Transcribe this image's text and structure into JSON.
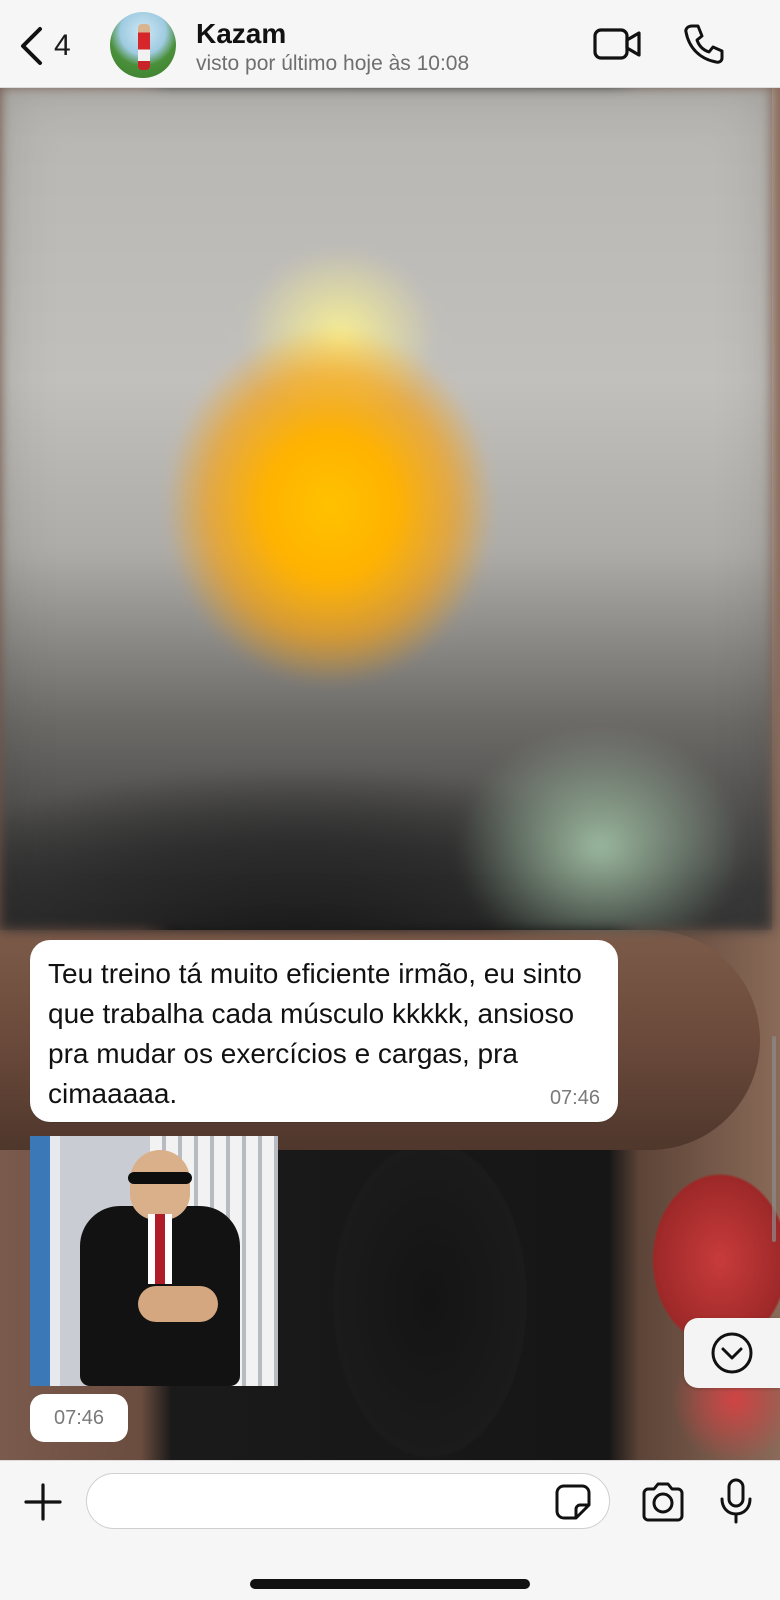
{
  "header": {
    "back_count": "4",
    "contact_name": "Kazam",
    "last_seen": "visto por último hoje às 10:08",
    "icons": {
      "back": "chevron-left-icon",
      "video": "video-camera-icon",
      "phone": "phone-icon"
    }
  },
  "messages": [
    {
      "type": "text",
      "direction": "incoming",
      "text": "Teu treino tá muito eficiente irmão, eu sinto que trabalha cada músculo kkkkk, ansioso pra mudar os exercícios e cargas, pra cimaaaaa.",
      "time": "07:46"
    },
    {
      "type": "sticker",
      "direction": "incoming",
      "time": "07:46"
    }
  ],
  "input": {
    "value": "",
    "icons": {
      "plus": "plus-icon",
      "sticker": "sticker-icon",
      "camera": "camera-icon",
      "mic": "microphone-icon"
    }
  },
  "scroll_button_icon": "chevron-down-circle-icon",
  "colors": {
    "header_bg": "#f6f6f6",
    "bubble_bg": "#ffffff",
    "text": "#111111",
    "muted": "#6f6f6f"
  }
}
